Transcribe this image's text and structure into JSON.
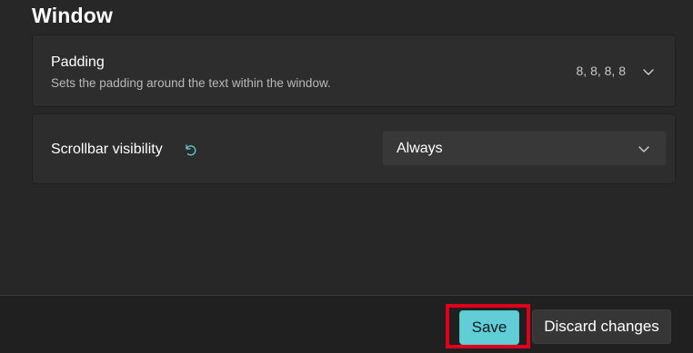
{
  "section": {
    "title": "Window"
  },
  "padding_setting": {
    "title": "Padding",
    "description": "Sets the padding around the text within the window.",
    "value": "8, 8, 8, 8",
    "chevron_icon": "chevron-down-icon"
  },
  "scrollbar_setting": {
    "title": "Scrollbar visibility",
    "reset_icon": "reset-icon",
    "dropdown": {
      "selected": "Always",
      "chevron_icon": "chevron-down-icon"
    }
  },
  "footer": {
    "save_label": "Save",
    "discard_label": "Discard changes"
  },
  "colors": {
    "accent": "#60cdd7",
    "highlight": "#e0001b",
    "background": "#272727",
    "card": "#2d2d2d"
  }
}
